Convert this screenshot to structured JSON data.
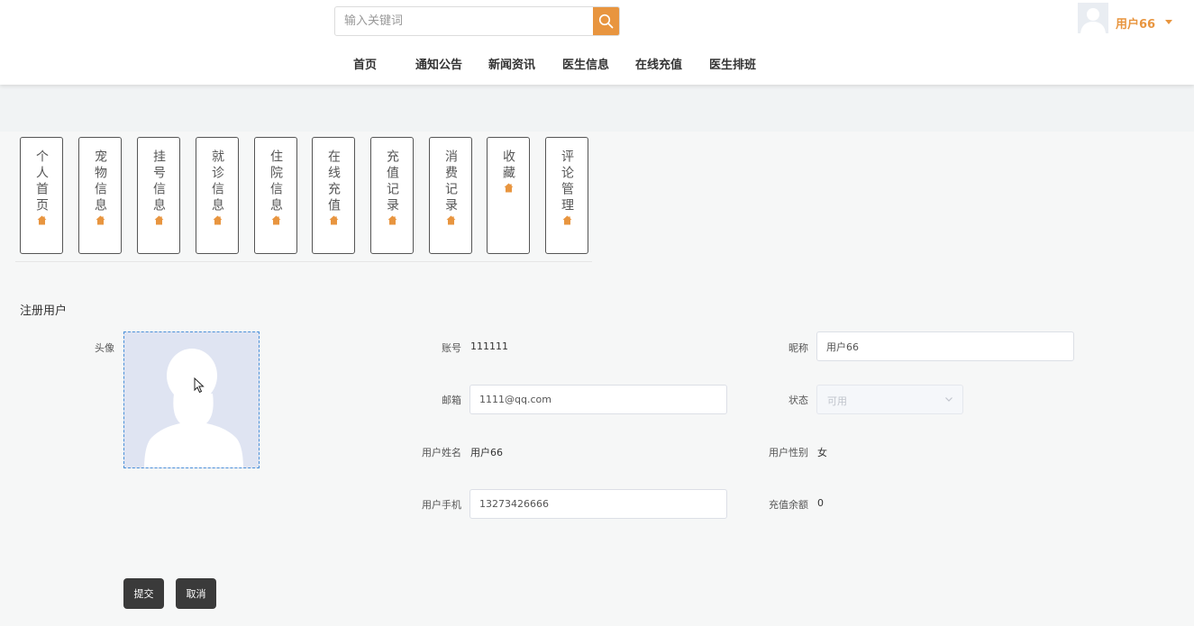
{
  "header": {
    "search": {
      "placeholder": "输入关键词",
      "icon": "search-icon"
    },
    "user": {
      "name": "用户66",
      "avatar_icon": "user-avatar-icon"
    },
    "accent_color": "#e8953f"
  },
  "nav": [
    "首页",
    "通知公告",
    "新闻资讯",
    "医生信息",
    "在线充值",
    "医生排班"
  ],
  "menu": [
    {
      "label": "个人首页",
      "icon": "home-icon"
    },
    {
      "label": "宠物信息",
      "icon": "home-icon"
    },
    {
      "label": "挂号信息",
      "icon": "home-icon"
    },
    {
      "label": "就诊信息",
      "icon": "home-icon"
    },
    {
      "label": "住院信息",
      "icon": "home-icon"
    },
    {
      "label": "在线充值",
      "icon": "home-icon"
    },
    {
      "label": "充值记录",
      "icon": "home-icon"
    },
    {
      "label": "消费记录",
      "icon": "home-icon"
    },
    {
      "label": "收藏",
      "icon": "home-icon"
    },
    {
      "label": "评论管理",
      "icon": "home-icon"
    }
  ],
  "form": {
    "title": "注册用户",
    "avatar_label": "头像",
    "account_label": "账号",
    "account_value": "111111",
    "nickname_label": "昵称",
    "nickname_value": "用户66",
    "email_label": "邮箱",
    "email_value": "1111@qq.com",
    "status_label": "状态",
    "status_value": "可用",
    "realname_label": "用户姓名",
    "realname_value": "用户66",
    "gender_label": "用户性别",
    "gender_value": "女",
    "phone_label": "用户手机",
    "phone_value": "13273426666",
    "balance_label": "充值余额",
    "balance_value": "0"
  },
  "buttons": {
    "submit": "提交",
    "cancel": "取消"
  }
}
